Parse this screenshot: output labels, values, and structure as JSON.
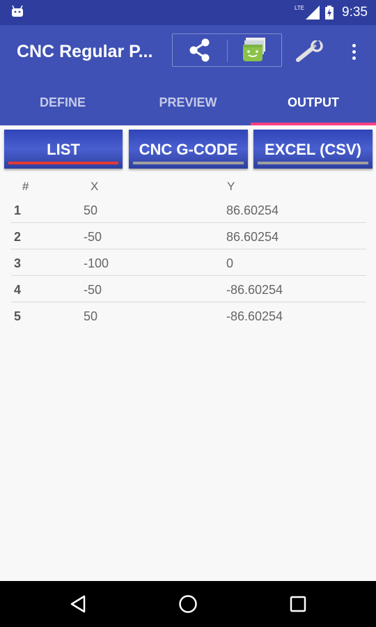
{
  "status_bar": {
    "time": "9:35",
    "network_label": "LTE",
    "icons": [
      "android-icon",
      "lte-signal-icon",
      "battery-charging-icon"
    ]
  },
  "app_bar": {
    "title": "CNC Regular P...",
    "actions": [
      "share-icon",
      "android-store-icon",
      "wrench-icon",
      "overflow-menu-icon"
    ]
  },
  "tabs": [
    {
      "label": "DEFINE",
      "active": false
    },
    {
      "label": "PREVIEW",
      "active": false
    },
    {
      "label": "OUTPUT",
      "active": true
    }
  ],
  "sub_tabs": [
    {
      "label": "LIST",
      "active": true
    },
    {
      "label": "CNC G-CODE",
      "active": false
    },
    {
      "label": "EXCEL (CSV)",
      "active": false
    }
  ],
  "table": {
    "columns": [
      "#",
      "X",
      "Y"
    ],
    "rows": [
      {
        "num": "1",
        "x": "50",
        "y": "86.60254"
      },
      {
        "num": "2",
        "x": "-50",
        "y": "86.60254"
      },
      {
        "num": "3",
        "x": "-100",
        "y": "0"
      },
      {
        "num": "4",
        "x": "-50",
        "y": "-86.60254"
      },
      {
        "num": "5",
        "x": "50",
        "y": "-86.60254"
      }
    ]
  },
  "nav_bar": {
    "buttons": [
      "back-icon",
      "home-icon",
      "recents-icon"
    ]
  },
  "colors": {
    "primary": "#3f51b5",
    "primary_dark": "#2f3e9e",
    "accent": "#ff4081",
    "active_underline": "#e53935"
  }
}
